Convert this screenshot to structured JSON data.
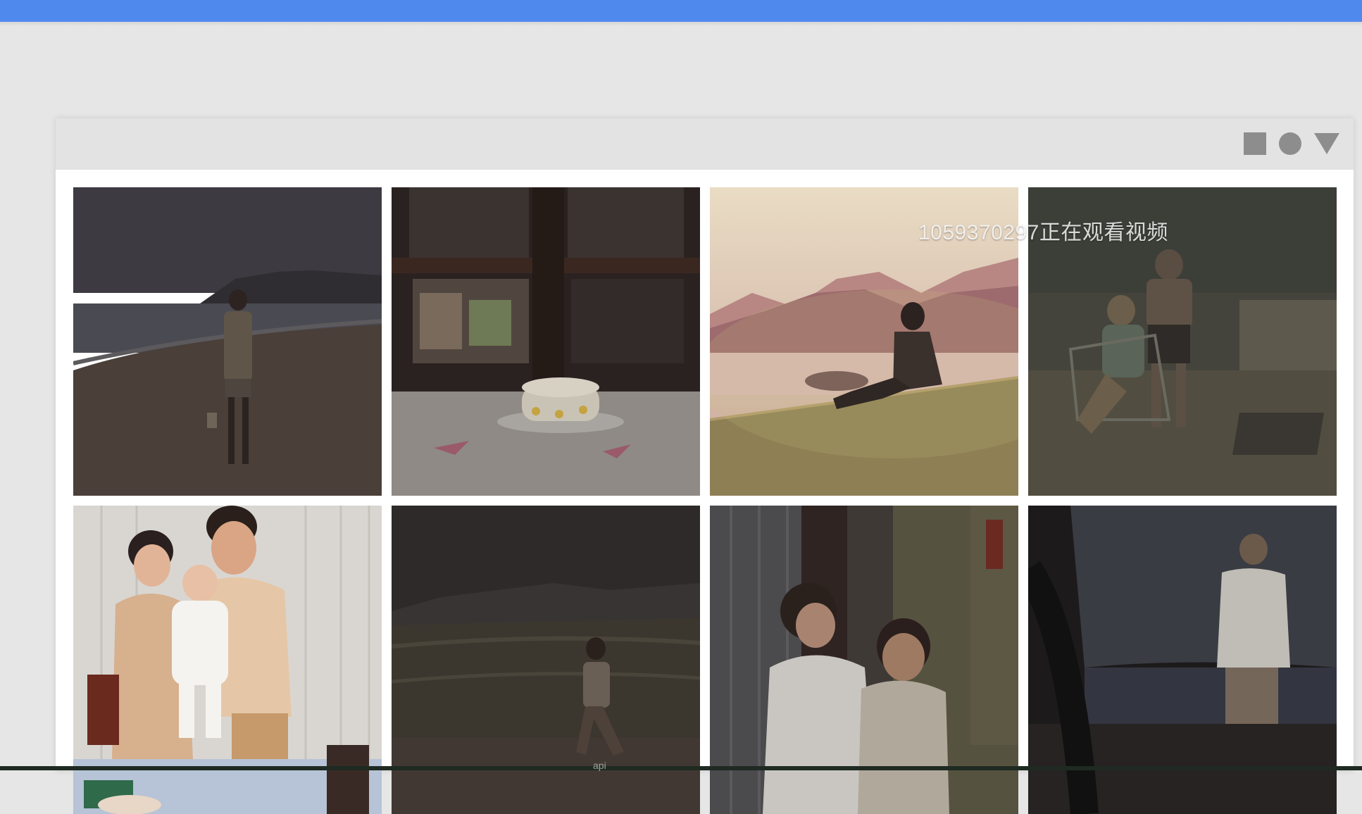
{
  "watermark": {
    "text": "1059370297正在观看视频"
  },
  "caption": {
    "text": "api"
  },
  "window_controls": [
    {
      "name": "square-icon"
    },
    {
      "name": "circle-icon"
    },
    {
      "name": "triangle-down-icon"
    }
  ],
  "colors": {
    "top_bar": "#5089ee",
    "background": "#e6e6e6",
    "titlebar": "#e3e3e3",
    "control_icons": "#8d8d8d"
  }
}
